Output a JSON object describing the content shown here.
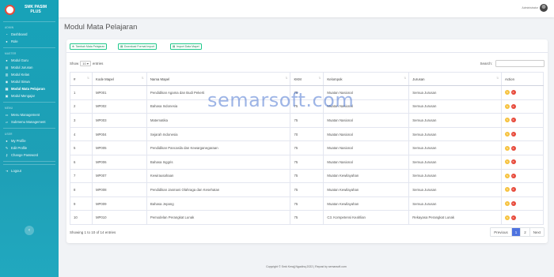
{
  "sidebar": {
    "brand": "SMK PASIM PLUS",
    "sections": [
      {
        "heading": "ADMIN",
        "items": [
          {
            "label": "Dashboard",
            "icon": "gauge-icon"
          },
          {
            "label": "Role",
            "icon": "user-icon"
          }
        ]
      },
      {
        "heading": "MASTER",
        "items": [
          {
            "label": "Modul Guru",
            "icon": "user-icon"
          },
          {
            "label": "Modul Jurusan",
            "icon": "book-icon"
          },
          {
            "label": "Modul Kelas",
            "icon": "building-icon"
          },
          {
            "label": "Modul Siswa",
            "icon": "users-icon"
          },
          {
            "label": "Modul Mata Pelajaran",
            "icon": "book-icon",
            "active": true
          },
          {
            "label": "Modul Mengajar",
            "icon": "clipboard-icon"
          }
        ]
      },
      {
        "heading": "MENU",
        "items": [
          {
            "label": "Menu Management",
            "icon": "folder-icon"
          },
          {
            "label": "Submenu Management",
            "icon": "folder-open-icon"
          }
        ]
      },
      {
        "heading": "USER",
        "items": [
          {
            "label": "My Profile",
            "icon": "user-icon"
          },
          {
            "label": "Edit Profile",
            "icon": "edit-icon"
          },
          {
            "label": "Change Password",
            "icon": "key-icon"
          }
        ]
      },
      {
        "heading": "",
        "items": [
          {
            "label": "Logout",
            "icon": "logout-icon"
          }
        ]
      }
    ]
  },
  "topbar": {
    "username": "Administrator"
  },
  "page": {
    "title": "Modul Mata Pelajaran"
  },
  "toolbar": {
    "add_label": "Tambah Mata Pelajaran",
    "download_label": "Download Format Import",
    "import_label": "Import Data Mapel"
  },
  "table_controls": {
    "show": "Show",
    "entries_value": "10",
    "entries": "entries",
    "search": "Search:"
  },
  "table": {
    "headers": [
      "#",
      "Kode Mapel",
      "Nama Mapel",
      "KKM",
      "Kelompok",
      "Jurusan",
      "Action"
    ],
    "rows": [
      [
        "1",
        "MP001",
        "Pendidikan Agama dan Budi Pekerti",
        "75",
        "Muatan Nasional",
        "Semua Jurusan"
      ],
      [
        "2",
        "MP002",
        "Bahasa Indonesia",
        "75",
        "Muatan Nasional",
        "Semua Jurusan"
      ],
      [
        "3",
        "MP003",
        "Matematika",
        "75",
        "Muatan Nasional",
        "Semua Jurusan"
      ],
      [
        "4",
        "MP004",
        "Sejarah Indonesia",
        "70",
        "Muatan Nasional",
        "Semua Jurusan"
      ],
      [
        "5",
        "MP005",
        "Pendidikan Pancasila dan Kewarganegaraan",
        "75",
        "Muatan Nasional",
        "Semua Jurusan"
      ],
      [
        "6",
        "MP006",
        "Bahasa Inggris",
        "75",
        "Muatan Nasional",
        "Semua Jurusan"
      ],
      [
        "7",
        "MP007",
        "Kewirausahaan",
        "75",
        "Muatan Kewilayahan",
        "Semua Jurusan"
      ],
      [
        "8",
        "MP008",
        "Pendidikan Jasmani Olahraga dan Kesehatan",
        "75",
        "Muatan Kewilayahan",
        "Semua Jurusan"
      ],
      [
        "9",
        "MP009",
        "Bahasa Jepang",
        "75",
        "Muatan Kewilayahan",
        "Semua Jurusan"
      ],
      [
        "10",
        "MP010",
        "Pemodelan Perangkat Lunak",
        "75",
        "C3. Kompetensi Keahlian",
        "Rekayasa Perangkat Lunak"
      ]
    ]
  },
  "pagination": {
    "info": "Showing 1 to 10 of 14 entries",
    "previous": "Previous",
    "pages": [
      "1",
      "2"
    ],
    "next": "Next"
  },
  "watermark": "semarsoft.com",
  "footer": "Copyright © Smk Kerajj Ngadinq 2022 | Repost by semarsoft.com"
}
